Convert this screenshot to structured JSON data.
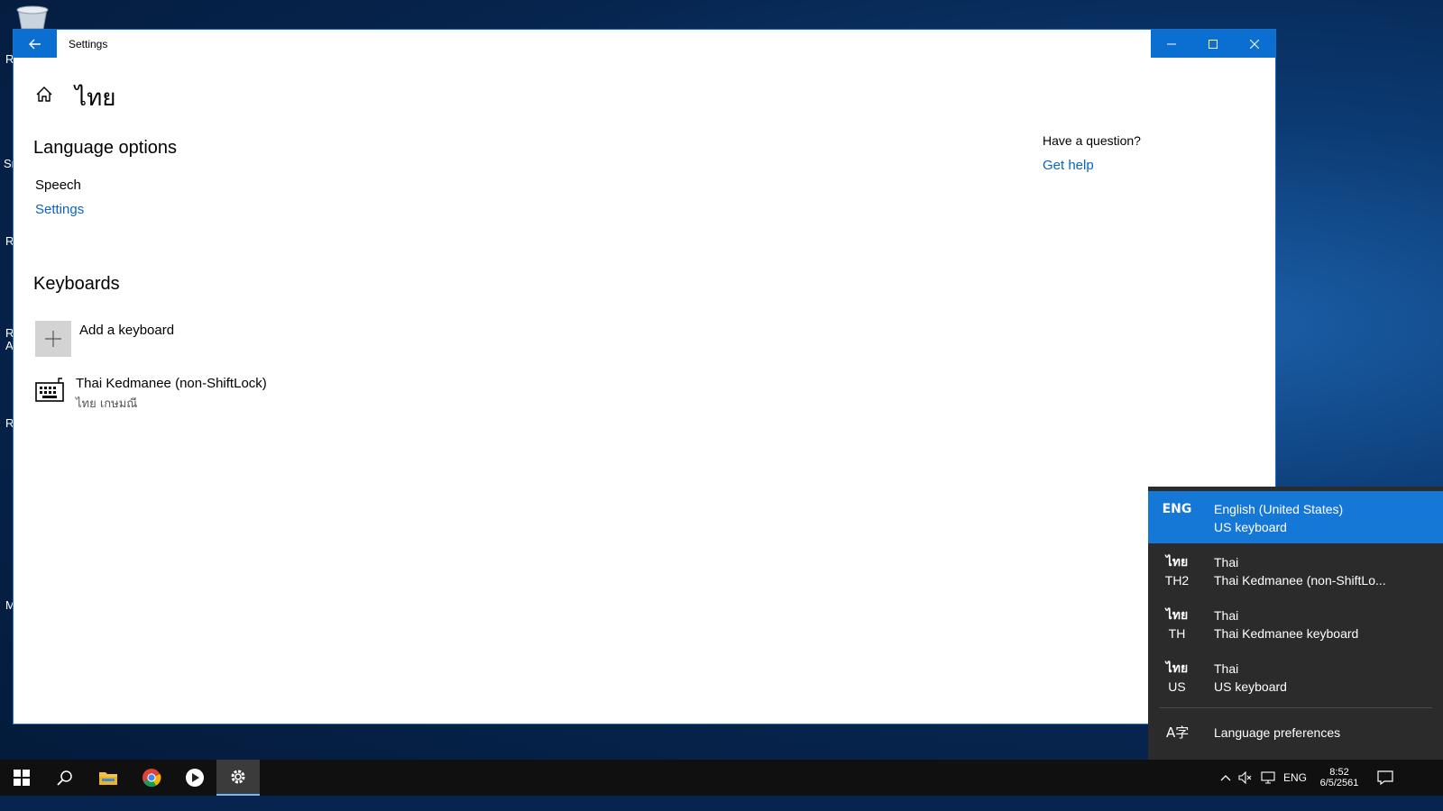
{
  "window": {
    "title": "Settings",
    "back_icon": "back-arrow-icon",
    "minimize_icon": "minimize-icon",
    "maximize_icon": "maximize-icon",
    "close_icon": "close-icon"
  },
  "page": {
    "title": "ไทย",
    "home_icon": "home-icon"
  },
  "language_options": {
    "heading": "Language options",
    "speech_label": "Speech",
    "settings_link": "Settings"
  },
  "keyboards": {
    "heading": "Keyboards",
    "add_label": "Add a keyboard",
    "items": [
      {
        "name": "Thai Kedmanee (non-ShiftLock)",
        "subtitle": "ไทย เกษมณี",
        "icon": "keyboard-icon"
      }
    ]
  },
  "help": {
    "question": "Have a question?",
    "link": "Get help"
  },
  "language_flyout": {
    "items": [
      {
        "code1": "ENG",
        "code2": "",
        "line1": "English (United States)",
        "line2": "US keyboard",
        "selected": true
      },
      {
        "code1": "ไทย",
        "code2": "TH2",
        "line1": "Thai",
        "line2": "Thai Kedmanee (non-ShiftLo...",
        "selected": false
      },
      {
        "code1": "ไทย",
        "code2": "TH",
        "line1": "Thai",
        "line2": "Thai Kedmanee keyboard",
        "selected": false
      },
      {
        "code1": "ไทย",
        "code2": "US",
        "line1": "Thai",
        "line2": "US keyboard",
        "selected": false
      }
    ],
    "preferences_label": "Language preferences",
    "preferences_icon": "language-icon",
    "preferences_glyph": "A字"
  },
  "taskbar": {
    "apps": [
      "windows-start-icon",
      "search-icon",
      "file-explorer-icon",
      "chrome-icon",
      "media-player-icon",
      "settings-gear-icon"
    ],
    "tray": {
      "input_indicator": "ENG",
      "time": "8:52",
      "date": "6/5/2561"
    }
  },
  "colors": {
    "accent": "#0a6fd1",
    "link": "#0a63c7",
    "flyout_bg": "#2b2b2b",
    "flyout_selected": "#1678d6"
  }
}
